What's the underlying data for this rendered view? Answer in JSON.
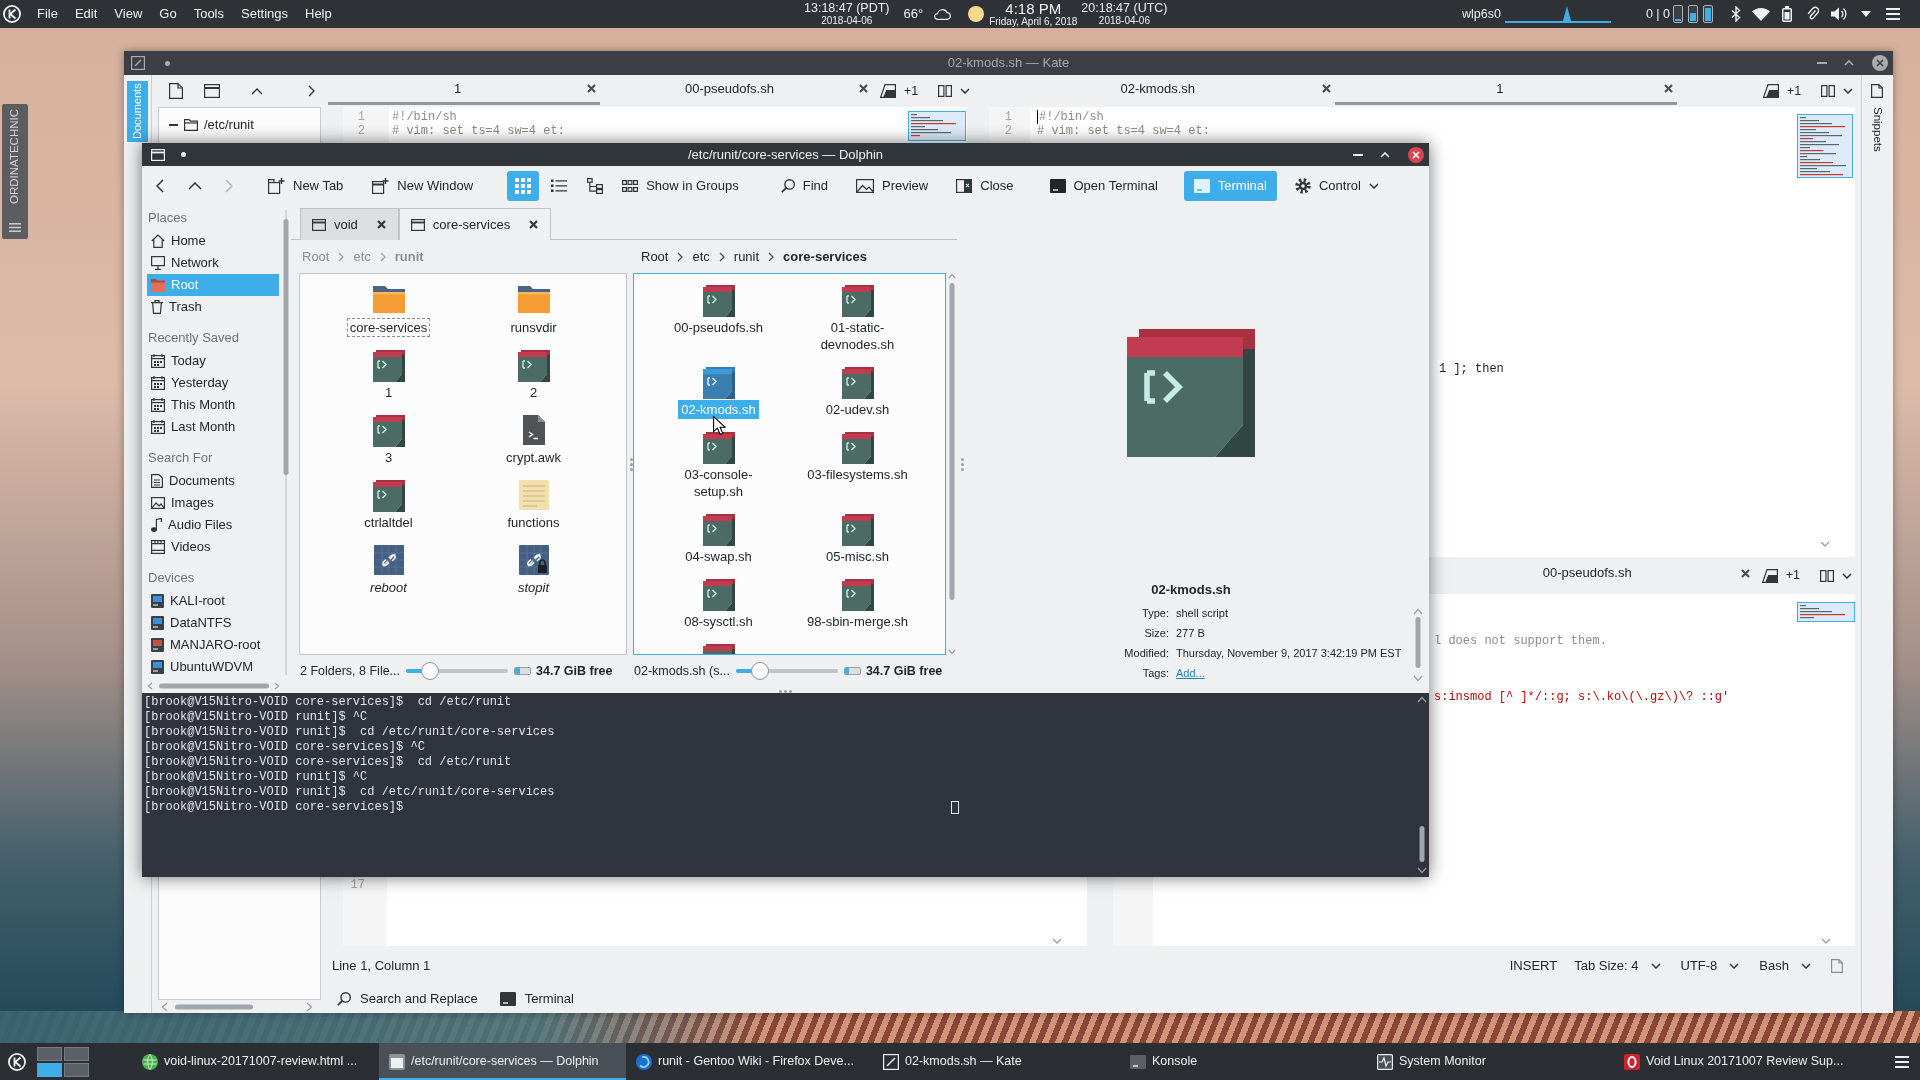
{
  "top_panel": {
    "menu": [
      "File",
      "Edit",
      "View",
      "Go",
      "Tools",
      "Settings",
      "Help"
    ],
    "clocks": [
      {
        "time": "13:18:47 (PDT)",
        "date": "2018-04-06"
      },
      {
        "time": "4:18 PM",
        "date": "Friday, April 6, 2018"
      },
      {
        "time": "20:18:47 (UTC)",
        "date": "2018-04-06"
      }
    ],
    "temperature": "66°",
    "network": {
      "interface": "wlp6s0",
      "traffic": "0 | 0"
    }
  },
  "desktop_widget": {
    "title": "ORDINATECHNIC"
  },
  "kate": {
    "title": "02-kmods.sh — Kate",
    "sidebar_tab": {
      "label": "Documents",
      "selected": true
    },
    "documents": [
      {
        "label": "/etc/runit",
        "expanded": true
      }
    ],
    "top_left_view": {
      "tabs": [
        {
          "label": "1",
          "selected": true
        },
        {
          "label": "00-pseudofs.sh",
          "selected": false
        }
      ],
      "more": "+1",
      "lines": [
        {
          "number": "1",
          "text": "#!/bin/sh",
          "kind": "comment"
        },
        {
          "number": "2",
          "text": "# vim: set ts=4 sw=4 et:",
          "kind": "comment"
        }
      ]
    },
    "top_right_view": {
      "tabs": [
        {
          "label": "02-kmods.sh",
          "selected": false
        },
        {
          "label": "1",
          "selected": true
        }
      ],
      "more": "+1",
      "cursor": true,
      "lines": [
        {
          "number": "1",
          "text": "#!/bin/sh",
          "kind": "comment"
        },
        {
          "number": "2",
          "text": "# vim: set ts=4 sw=4 et:",
          "kind": "comment"
        }
      ],
      "fragments": [
        {
          "kind": "code",
          "text": "1 ]; then"
        }
      ]
    },
    "bottom_left_view": {
      "line_numbers": [
        "17"
      ]
    },
    "bottom_right_view": {
      "tabs": [
        {
          "label": "00-pseudofs.sh",
          "selected": false
        }
      ],
      "more": "+1",
      "fragments": [
        {
          "kind": "comment",
          "text": "l does not support them."
        },
        {
          "kind": "string",
          "text": "s:insmod [^ ]*/::g; s:\\.ko\\(\\.gz\\)\\? ::g'"
        }
      ]
    },
    "right_sidebar_tab": {
      "label": "Snippets",
      "selected": false
    },
    "status_bar": {
      "position": "Line 1, Column 1",
      "mode": "INSERT",
      "dropdowns": [
        "Tab Size: 4",
        "UTF-8",
        "Bash"
      ]
    },
    "tool_views": [
      "Search and Replace",
      "Terminal"
    ]
  },
  "dolphin": {
    "title": "/etc/runit/core-services — Dolphin",
    "forward_disabled": true,
    "toolbar": [
      {
        "label": "New Tab",
        "kind": "action",
        "checked": false
      },
      {
        "label": "New Window",
        "kind": "action",
        "checked": false
      }
    ],
    "view_modes": [
      {
        "selected": true
      },
      {
        "selected": false
      },
      {
        "selected": false
      }
    ],
    "actions": [
      {
        "label": "Show in Groups",
        "kind": "action",
        "checked": false
      },
      {
        "label": "Find",
        "kind": "action",
        "checked": false
      },
      {
        "label": "Preview",
        "kind": "action",
        "checked": false
      },
      {
        "label": "Close",
        "kind": "action",
        "checked": false
      },
      {
        "label": "Open Terminal",
        "kind": "action",
        "checked": false
      },
      {
        "label": "Terminal",
        "kind": "action",
        "checked": true
      },
      {
        "label": "Control",
        "kind": "menu",
        "checked": false
      }
    ],
    "places": [
      {
        "heading": "Places",
        "items": [
          {
            "label": "Home",
            "selected": false
          },
          {
            "label": "Network",
            "selected": false
          },
          {
            "label": "Root",
            "selected": true
          },
          {
            "label": "Trash",
            "selected": false
          }
        ]
      },
      {
        "heading": "Recently Saved",
        "items": [
          {
            "label": "Today",
            "selected": false
          },
          {
            "label": "Yesterday",
            "selected": false
          },
          {
            "label": "This Month",
            "selected": false
          },
          {
            "label": "Last Month",
            "selected": false
          }
        ]
      },
      {
        "heading": "Search For",
        "items": [
          {
            "label": "Documents",
            "selected": false
          },
          {
            "label": "Images",
            "selected": false
          },
          {
            "label": "Audio Files",
            "selected": false
          },
          {
            "label": "Videos",
            "selected": false
          }
        ]
      },
      {
        "heading": "Devices",
        "items": [
          {
            "label": "KALI-root",
            "selected": false
          },
          {
            "label": "DataNTFS",
            "selected": false
          },
          {
            "label": "MANJARO-root",
            "selected": false
          },
          {
            "label": "UbuntuWDVM",
            "selected": false
          }
        ]
      }
    ],
    "tabs": [
      {
        "label": "void",
        "selected": false
      },
      {
        "label": "core-services",
        "selected": true
      }
    ],
    "panes": [
      {
        "active": false,
        "breadcrumb": [
          "Root",
          "etc",
          "runit"
        ],
        "items": [
          {
            "name": "core-services",
            "kind": "folder",
            "selected": false,
            "focused": true
          },
          {
            "name": "runsvdir",
            "kind": "folder",
            "selected": false,
            "focused": false
          },
          {
            "name": "1",
            "kind": "script",
            "selected": false,
            "focused": false
          },
          {
            "name": "2",
            "kind": "script",
            "selected": false,
            "focused": false
          },
          {
            "name": "3",
            "kind": "script",
            "selected": false,
            "focused": false
          },
          {
            "name": "crypt.awk",
            "kind": "program",
            "selected": false,
            "focused": false
          },
          {
            "name": "ctrlaltdel",
            "kind": "script",
            "selected": false,
            "focused": false
          },
          {
            "name": "functions",
            "kind": "text",
            "selected": false,
            "focused": false
          },
          {
            "name": "reboot",
            "kind": "symlink",
            "selected": false,
            "focused": false
          },
          {
            "name": "stopit",
            "kind": "locked-symlink",
            "selected": false,
            "focused": false
          }
        ],
        "status": "2 Folders, 8 File...",
        "zoom": {
          "level": 0.18
        },
        "free_space": {
          "text": "34.7 GiB free",
          "level": 0.3
        }
      },
      {
        "active": true,
        "breadcrumb": [
          "Root",
          "etc",
          "runit",
          "core-services"
        ],
        "items": [
          {
            "name": "00-pseudofs.sh",
            "kind": "script",
            "selected": false,
            "focused": false
          },
          {
            "name": "01-static-devnodes.sh",
            "kind": "script",
            "selected": false,
            "focused": false
          },
          {
            "name": "02-kmods.sh",
            "kind": "script",
            "selected": true,
            "focused": false
          },
          {
            "name": "02-udev.sh",
            "kind": "script",
            "selected": false,
            "focused": false
          },
          {
            "name": "03-console-setup.sh",
            "kind": "script",
            "selected": false,
            "focused": false
          },
          {
            "name": "03-filesystems.sh",
            "kind": "script",
            "selected": false,
            "focused": false
          },
          {
            "name": "04-swap.sh",
            "kind": "script",
            "selected": false,
            "focused": false
          },
          {
            "name": "05-misc.sh",
            "kind": "script",
            "selected": false,
            "focused": false
          },
          {
            "name": "08-sysctl.sh",
            "kind": "script",
            "selected": false,
            "focused": false
          },
          {
            "name": "98-sbin-merge.sh",
            "kind": "script",
            "selected": false,
            "focused": false
          },
          {
            "kind": "script",
            "selected": false,
            "focused": false
          }
        ],
        "status": "02-kmods.sh (s...",
        "zoom": {
          "level": 0.18
        },
        "free_space": {
          "text": "34.7 GiB free",
          "level": 0.3
        }
      }
    ],
    "information": {
      "name": "02-kmods.sh",
      "fields": [
        {
          "label": "Type:",
          "value": "shell script",
          "kind": "text"
        },
        {
          "label": "Size:",
          "value": "277 B",
          "kind": "text"
        },
        {
          "label": "Modified:",
          "value": "Thursday, November 9, 2017 3:42:19 PM EST",
          "kind": "text"
        },
        {
          "label": "Tags:",
          "value": "Add...",
          "kind": "link"
        }
      ]
    },
    "terminal": {
      "cursor": true,
      "lines": [
        "[brook@V15Nitro-VOID core-services]$  cd /etc/runit",
        "[brook@V15Nitro-VOID runit]$ ^C",
        "[brook@V15Nitro-VOID runit]$  cd /etc/runit/core-services",
        "[brook@V15Nitro-VOID core-services]$ ^C",
        "[brook@V15Nitro-VOID core-services]$  cd /etc/runit",
        "[brook@V15Nitro-VOID runit]$ ^C",
        "[brook@V15Nitro-VOID runit]$  cd /etc/runit/core-services",
        "[brook@V15Nitro-VOID core-services]$"
      ]
    }
  },
  "taskbar": {
    "desktops": [
      {
        "selected": false
      },
      {
        "selected": false
      },
      {
        "selected": true
      },
      {
        "selected": false
      }
    ],
    "tasks": [
      {
        "label": "void-linux-20171007-review.html ...",
        "selected": false
      },
      {
        "label": "/etc/runit/core-services — Dolphin",
        "selected": true
      },
      {
        "label": "runit - Gentoo Wiki - Firefox Deve...",
        "selected": false
      },
      {
        "label": "02-kmods.sh — Kate",
        "selected": false
      },
      {
        "label": "Konsole",
        "selected": false
      },
      {
        "label": "System Monitor",
        "selected": false
      },
      {
        "label": "Void Linux 20171007 Review Sup...",
        "selected": false
      }
    ]
  }
}
